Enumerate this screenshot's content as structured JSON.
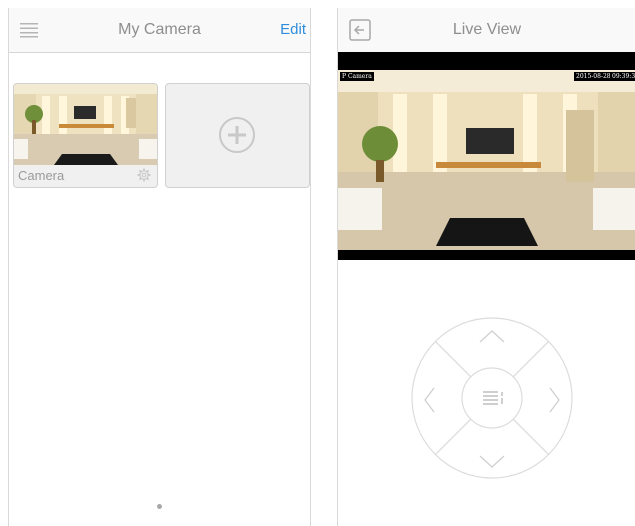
{
  "home": {
    "title": "My Camera",
    "edit_label": "Edit",
    "camera_name": "Camera"
  },
  "live": {
    "title": "Live View",
    "osd_name": "P Camera",
    "osd_date": "2015-08-28",
    "osd_time": "09:39:3"
  },
  "colors": {
    "accent": "#2f8ddb",
    "title_text": "#8e8e8e",
    "border": "#d6d6d6"
  },
  "icons": {
    "menu": "menu-icon",
    "back": "back-icon",
    "settings": "gear-icon",
    "add": "add-icon",
    "ptz_menu": "menu-icon"
  }
}
